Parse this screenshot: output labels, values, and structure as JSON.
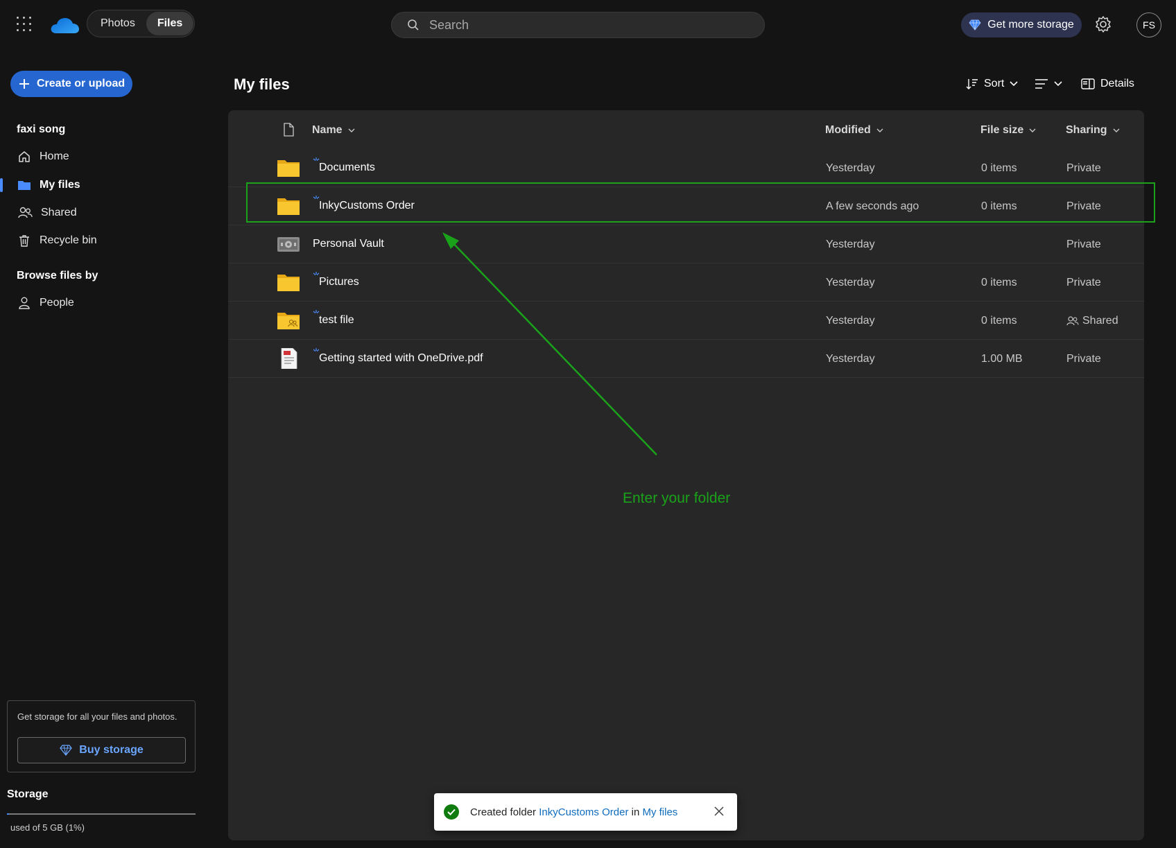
{
  "topbar": {
    "apps": [
      "Photos",
      "Files"
    ],
    "active_app": "Files",
    "search_placeholder": "Search",
    "get_storage_label": "Get more storage",
    "avatar_initials": "FS"
  },
  "sidebar": {
    "create_label": "Create or upload",
    "user_name": "faxi song",
    "nav": [
      {
        "label": "Home",
        "icon": "home-icon"
      },
      {
        "label": "My files",
        "icon": "folder-icon",
        "active": true
      },
      {
        "label": "Shared",
        "icon": "people-icon"
      },
      {
        "label": "Recycle bin",
        "icon": "trash-icon"
      }
    ],
    "browse_heading": "Browse files by",
    "browse_items": [
      {
        "label": "People",
        "icon": "person-icon"
      }
    ],
    "promo_text": "Get storage for all your files and photos.",
    "buy_label": "Buy storage",
    "storage_heading": "Storage",
    "storage_used_text": "used of 5 GB (1%)",
    "storage_fraction": 0.01
  },
  "main": {
    "title": "My files",
    "toolbar": {
      "sort_label": "Sort",
      "details_label": "Details"
    },
    "columns": {
      "name": "Name",
      "modified": "Modified",
      "size": "File size",
      "sharing": "Sharing"
    },
    "rows": [
      {
        "name": "Documents",
        "type": "folder",
        "modified": "Yesterday",
        "size": "0 items",
        "sharing": "Private",
        "new": true
      },
      {
        "name": "InkyCustoms Order",
        "type": "folder",
        "modified": "A few seconds ago",
        "size": "0 items",
        "sharing": "Private",
        "new": true
      },
      {
        "name": "Personal Vault",
        "type": "vault",
        "modified": "Yesterday",
        "size": "",
        "sharing": "Private",
        "new": false
      },
      {
        "name": "Pictures",
        "type": "folder",
        "modified": "Yesterday",
        "size": "0 items",
        "sharing": "Private",
        "new": true
      },
      {
        "name": "test file",
        "type": "shared-folder",
        "modified": "Yesterday",
        "size": "0 items",
        "sharing": "Shared",
        "new": true
      },
      {
        "name": "Getting started with OneDrive.pdf",
        "type": "pdf",
        "modified": "Yesterday",
        "size": "1.00 MB",
        "sharing": "Private",
        "new": true
      }
    ]
  },
  "annotation": {
    "text": "Enter your folder",
    "color": "#1aa31a"
  },
  "toast": {
    "prefix": "Created folder ",
    "folder_link": "InkyCustoms Order",
    "middle": " in ",
    "location_link": "My files"
  },
  "colors": {
    "accent": "#2566d0",
    "folder": "#f8c62f",
    "success": "#107c10"
  }
}
